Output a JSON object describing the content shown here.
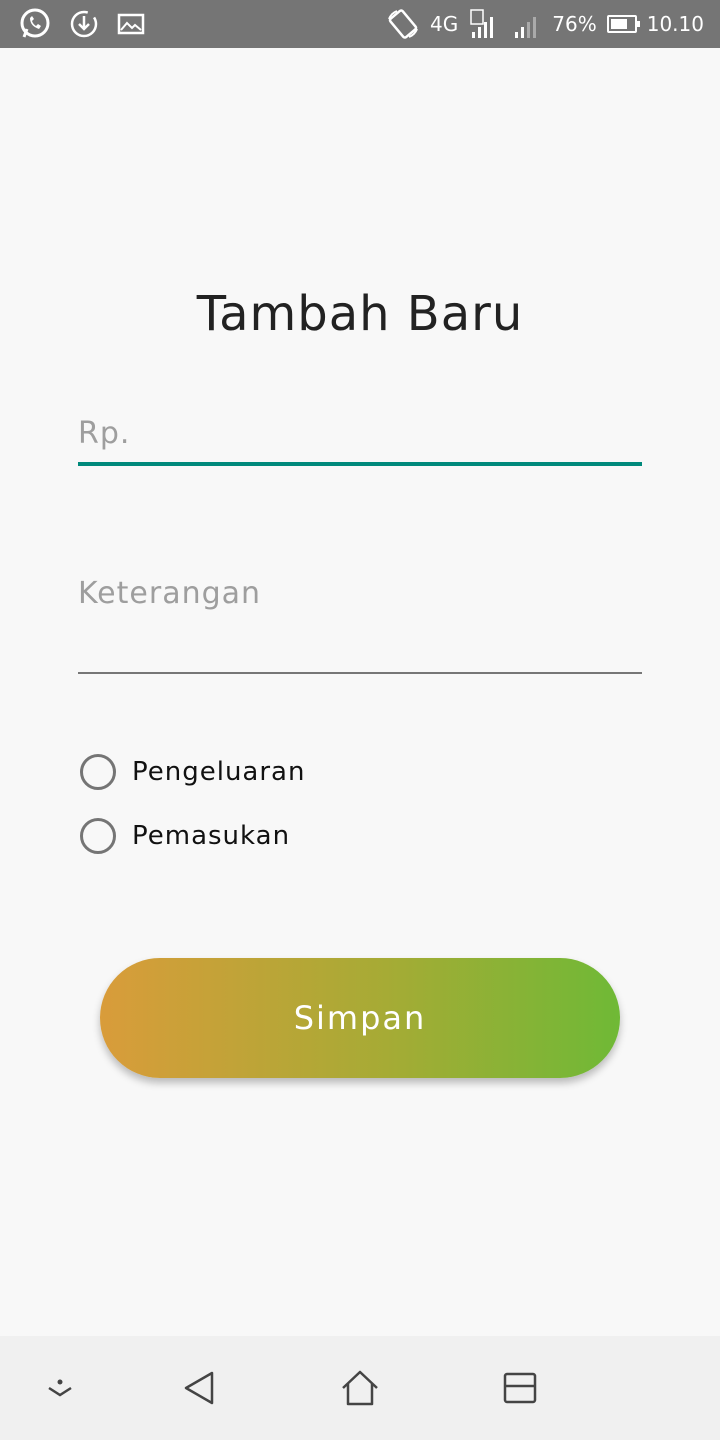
{
  "status_bar": {
    "network": "4G",
    "sim1": "1",
    "sim2": "2",
    "battery": "76%",
    "battery_level": 0.76,
    "time": "10.10",
    "icons": [
      "whatsapp-icon",
      "download-icon",
      "image-icon",
      "rotate-icon",
      "signal-icon",
      "battery-icon"
    ]
  },
  "form": {
    "title": "Tambah Baru",
    "amount_placeholder": "Rp.",
    "amount_value": "",
    "description_placeholder": "Keterangan",
    "description_value": "",
    "radio_options": [
      "Pengeluaran",
      "Pemasukan"
    ],
    "save_label": "Simpan"
  },
  "colors": {
    "accent": "#00897b",
    "button_start": "#d99c3a",
    "button_end": "#6fb936"
  },
  "nav_bar": {
    "icons": [
      "expand-icon",
      "back-icon",
      "home-icon",
      "recents-icon"
    ]
  }
}
